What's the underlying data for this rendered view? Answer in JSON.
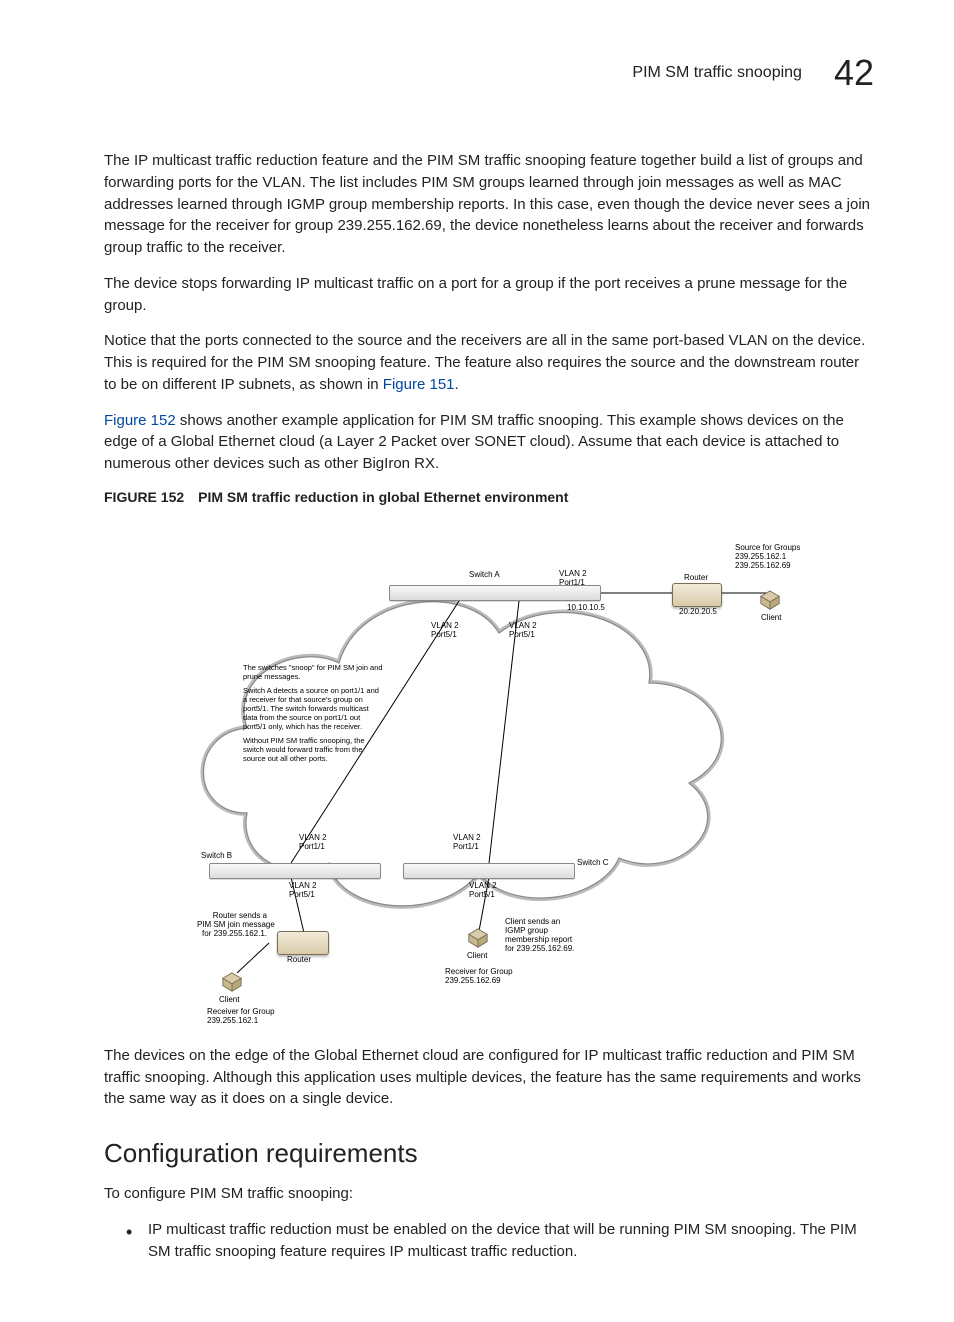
{
  "header": {
    "title": "PIM SM traffic snooping",
    "chapter": "42"
  },
  "paragraphs": {
    "p1": "The IP multicast traffic reduction feature and the PIM SM traffic snooping feature together build a list of groups and forwarding ports for the VLAN.  The list includes PIM SM groups learned through join messages as well as MAC addresses learned through IGMP group membership reports.  In this case, even though the device never sees a join message for the receiver for group 239.255.162.69, the device nonetheless learns about the receiver and forwards group traffic to the receiver.",
    "p2": "The device stops forwarding IP multicast traffic on a port for a group if the port receives a prune message for the group.",
    "p3a": "Notice that the ports connected to the source and the receivers are all in the same port-based VLAN on the device. This is required for the PIM SM snooping feature. The feature also requires the source and the downstream router to be on different IP subnets, as shown in ",
    "p3link": "Figure 151",
    "p3b": ".",
    "p4link": "Figure 152",
    "p4a": " shows another example application for PIM SM traffic snooping. This example shows devices on the edge of a Global Ethernet cloud (a Layer 2 Packet over SONET cloud). Assume that each device is attached to numerous other devices such as other BigIron RX.",
    "p5": "The devices on the edge of the Global Ethernet cloud are configured for IP multicast traffic reduction and PIM SM traffic snooping.  Although this application uses multiple devices, the feature has the same requirements and works the same way as it does on a single device.",
    "p6": "To configure PIM SM traffic snooping:",
    "bullet1": "IP multicast traffic reduction must be enabled on the device that will be running PIM SM snooping.  The PIM SM traffic snooping feature requires IP multicast traffic reduction."
  },
  "figure": {
    "number": "FIGURE 152",
    "title": "PIM SM traffic reduction in global Ethernet environment",
    "labels": {
      "switchA": "Switch A",
      "switchB": "Switch B",
      "switchC": "Switch C",
      "vlan2port11_a": "VLAN 2\nPort1/1",
      "vlan2port51_a1": "VLAN 2\nPort5/1",
      "vlan2port51_a2": "VLAN 2\nPort5/1",
      "vlan2port11_b": "VLAN 2\nPort1/1",
      "vlan2port11_c": "VLAN 2\nPort1/1",
      "vlan2port51_b": "VLAN 2\nPort5/1",
      "vlan2port51_c": "VLAN 2\nPort5/1",
      "ip_a": "10.10.10.5",
      "ip_src": "20.20.20.5",
      "router": "Router",
      "client": "Client",
      "sourceGroups": "Source for Groups\n239.255.162.1\n239.255.162.69",
      "rxGroupB": "Receiver for Group\n239.255.162.1",
      "rxGroupC": "Receiver for Group\n239.255.162.69",
      "routerNote": "Router sends a\nPIM SM join message\nfor 239.255.162.1.",
      "clientNote": "Client sends an\nIGMP group\nmembership report\nfor 239.255.162.69.",
      "snoop1": "The switches \"snoop\" for PIM SM join and prune messages.",
      "snoop2": "Switch A detects a source on port1/1 and a receiver for that source's group on port5/1. The switch forwards multicast data from the source on port1/1 out port5/1 only, which has the receiver.",
      "snoop3": "Without PIM SM traffic snooping, the switch would forward traffic from the source out all other ports."
    }
  },
  "h2": "Configuration requirements"
}
